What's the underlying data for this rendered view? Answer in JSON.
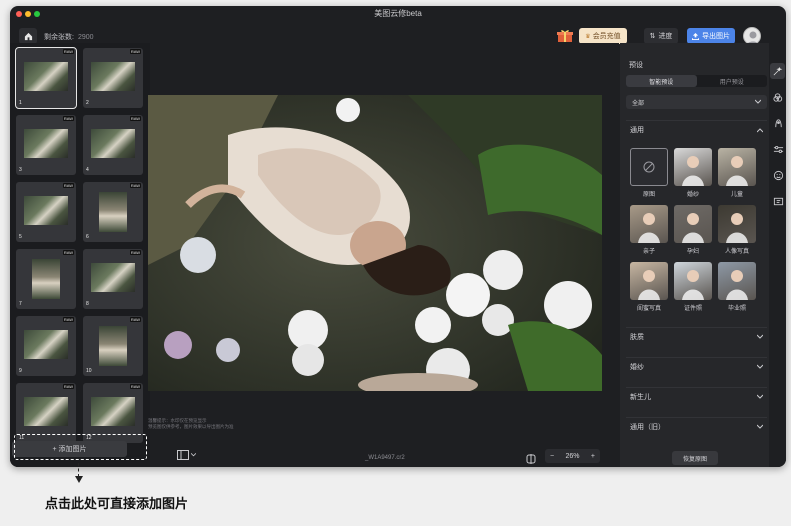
{
  "window": {
    "title": "美图云修beta"
  },
  "toolbar": {
    "credits_label": "剩余张数:",
    "credits_value": "2900",
    "vip_label": "会员充值",
    "progress_label": "进度",
    "export_label": "导出图片"
  },
  "filmstrip": {
    "badge": "RAW",
    "items": [
      {
        "index": "1",
        "portrait": false
      },
      {
        "index": "2",
        "portrait": false
      },
      {
        "index": "3",
        "portrait": false
      },
      {
        "index": "4",
        "portrait": false
      },
      {
        "index": "5",
        "portrait": false
      },
      {
        "index": "6",
        "portrait": true
      },
      {
        "index": "7",
        "portrait": true
      },
      {
        "index": "8",
        "portrait": false
      },
      {
        "index": "9",
        "portrait": false
      },
      {
        "index": "10",
        "portrait": true
      },
      {
        "index": "11",
        "portrait": false
      },
      {
        "index": "12",
        "portrait": false
      }
    ],
    "add_button": "+ 添加图片"
  },
  "preview": {
    "hint_line1": "温馨提示：水印仅在预览显示",
    "hint_line2": "预览图仅供参考，图片效果以导出图片为准",
    "filename": "_W1A9497.cr2",
    "zoom_value": "26%",
    "zoom_minus": "−",
    "zoom_plus": "+"
  },
  "panel": {
    "title": "预设",
    "tabs": [
      "智能预设",
      "用户预设"
    ],
    "filter_value": "全部",
    "expanded_section": "通用",
    "presets": [
      {
        "label": "原图",
        "color": "#2b2c30"
      },
      {
        "label": "婚纱",
        "color": "#d9d9d9"
      },
      {
        "label": "儿童",
        "color": "#b9b3a4"
      },
      {
        "label": "亲子",
        "color": "#a89a88"
      },
      {
        "label": "孕妇",
        "color": "#6e6a66"
      },
      {
        "label": "人像写真",
        "color": "#3d3a32"
      },
      {
        "label": "闺蜜写真",
        "color": "#c7b6a2"
      },
      {
        "label": "证件照",
        "color": "#cfd6dc"
      },
      {
        "label": "毕业照",
        "color": "#8e99a6"
      }
    ],
    "collapsed_sections": [
      "肤质",
      "婚纱",
      "新生儿",
      "通用（旧）"
    ],
    "restore_button": "恢复原图"
  },
  "iconbar": [
    "magic-wand-icon",
    "color-circles-icon",
    "portrait-retouch-icon",
    "sliders-icon",
    "face-icon",
    "batch-icon"
  ],
  "callout": {
    "text": "点击此处可直接添加图片"
  }
}
